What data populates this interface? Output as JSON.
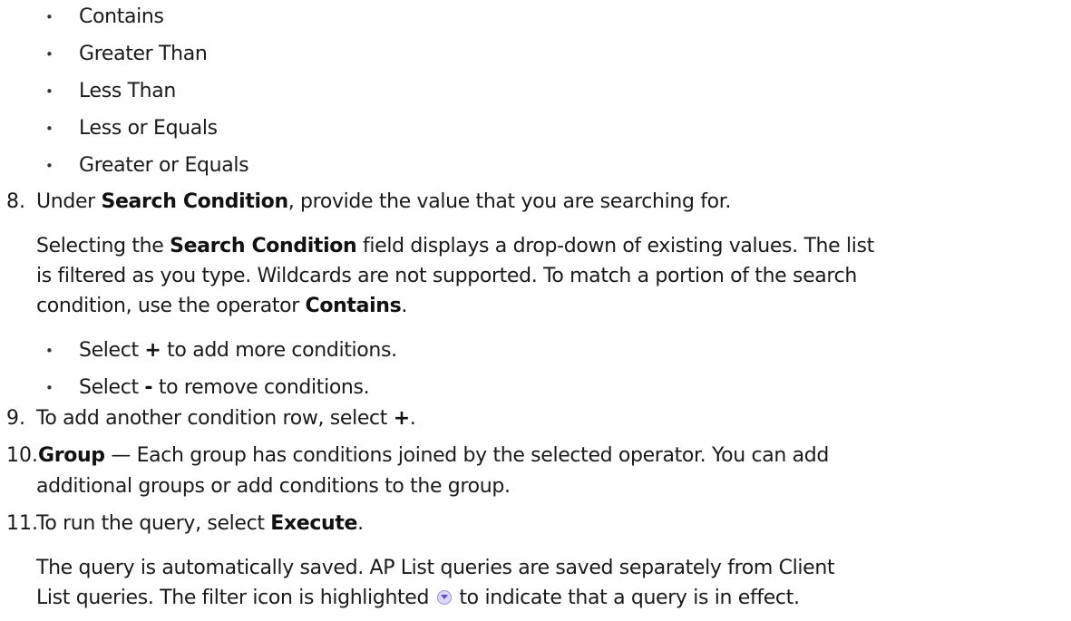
{
  "operator_bullets": [
    "Contains",
    "Greater Than",
    "Less Than",
    "Less or Equals",
    "Greater or Equals"
  ],
  "bullet_symbol": "•",
  "step8": {
    "number": "8.",
    "pre": "Under ",
    "bold": "Search Condition",
    "post": ", provide the value that you are searching for."
  },
  "step8_para": {
    "l1_pre": "Selecting the ",
    "l1_bold": "Search Condition",
    "l1_post": " field displays a drop-down of existing values. The list",
    "l2": "is filtered as you type. Wildcards are not supported. To match a portion of the search",
    "l3_pre": "condition, use the operator ",
    "l3_bold": "Contains",
    "l3_post": "."
  },
  "step8_bullets": [
    {
      "pre": "Select ",
      "bold": "+",
      "post": " to add more conditions."
    },
    {
      "pre": "Select ",
      "bold": "-",
      "post": " to remove conditions."
    }
  ],
  "step9": {
    "number": "9.",
    "pre": "To add another condition row, select ",
    "bold": "+",
    "post": "."
  },
  "step10": {
    "number": "10.",
    "bold": "Group",
    "l1_post": " — Each group has conditions joined by the selected operator. You can add",
    "l2": "additional groups or add conditions to the group."
  },
  "step11": {
    "number": "11.",
    "pre": "To run the query, select ",
    "bold": "Execute",
    "post": "."
  },
  "step11_para": {
    "l1": "The query is automatically saved. AP List queries are saved separately from Client",
    "l2_pre": "List queries. The filter icon is highlighted ",
    "l2_icon": "filter-highlighted-icon",
    "l2_post": " to indicate that a query is in effect."
  }
}
